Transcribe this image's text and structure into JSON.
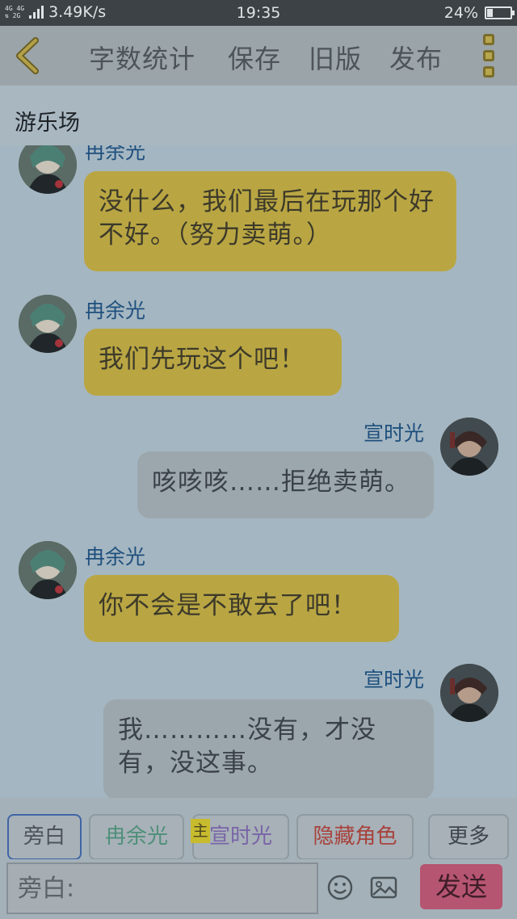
{
  "status_bar": {
    "network": "4G 4G 2G",
    "speed": "3.49K/s",
    "time": "19:35",
    "battery": "24%",
    "battery_level": 0.24
  },
  "toolbar": {
    "word_count": "字数统计",
    "save": "保存",
    "old_version": "旧版",
    "publish": "发布"
  },
  "scene": {
    "title": "游乐场"
  },
  "chat": {
    "partial_name": "冉余光",
    "messages": [
      {
        "side": "left",
        "text": "没什么，我们最后在玩那个好不好。（努力卖萌。）"
      },
      {
        "side": "left",
        "name": "冉余光",
        "text": "我们先玩这个吧！"
      },
      {
        "side": "right",
        "name": "宣时光",
        "text": "咳咳咳……拒绝卖萌。"
      },
      {
        "side": "left",
        "name": "冉余光",
        "text": "你不会是不敢去了吧！"
      },
      {
        "side": "right",
        "name": "宣时光",
        "text": "我…………没有，才没有，没这事。"
      }
    ]
  },
  "roles": {
    "narration": "旁白",
    "role1": "冉余光",
    "role1_color": "#4f8f7a",
    "main_tag": "主",
    "role2": "宣时光",
    "role2_color": "#7a64a8",
    "hidden_role": "隐藏角色",
    "hidden_color": "#a8423c",
    "more": "更多"
  },
  "composer": {
    "placeholder": "旁白:",
    "send": "发送",
    "emoji_icon": "smiley-icon",
    "image_icon": "image-icon"
  },
  "colors": {
    "left_bubble": "#b9a643",
    "right_bubble": "#9ca7ad",
    "speaker_name": "#1e4f7d",
    "send_button": "#b65571"
  }
}
